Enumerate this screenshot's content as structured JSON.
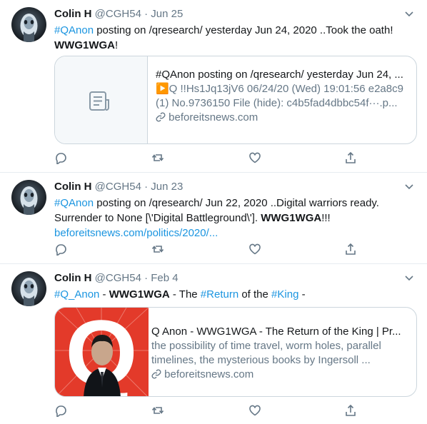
{
  "tweets": [
    {
      "user_name": "Colin H",
      "meta": "@CGH54 · Jun 25",
      "text": {
        "hashtag": "#QAnon",
        "body": " posting on /qresearch/ yesterday Jun 24, 2020 ..Took the oath!",
        "bold": "WWG1WGA",
        "end": "!"
      },
      "card": {
        "title": "#QAnon posting on /qresearch/ yesterday Jun 24, ...",
        "description": "▶️Q !!Hs1Jq13jV6  06/24/20 (Wed) 19:01:56 e2a8c9 (1)  No.9736150 File (hide): c4b5fad4dbbc54f···.p...",
        "domain": "beforeitsnews.com",
        "thumb_icon": "document-icon"
      }
    },
    {
      "user_name": "Colin H",
      "meta": "@CGH54 · Jun 23",
      "text": {
        "hashtag": "#QAnon",
        "body": " posting on /qresearch/ Jun 22, 2020 ..Digital warriors ready. Surrender to None [\\'Digital Battleground\\']. ",
        "bold": "WWG1WGA",
        "end": "!!!",
        "link": "beforeitsnews.com/politics/2020/..."
      }
    },
    {
      "user_name": "Colin H",
      "meta": "@CGH54 · Feb 4",
      "text": {
        "hashtag1": "#Q_Anon",
        "sep1": " - ",
        "bold": "WWG1WGA",
        "sep2": " - The ",
        "hashtag2": "#Return",
        "sep3": " of the ",
        "hashtag3": "#King",
        "end": " -"
      },
      "card": {
        "title": "Q Anon - WWG1WGA - The Return of the King | Pr...",
        "description": "the possibility of time travel, worm holes, parallel timelines, the mysterious books by Ingersoll ...",
        "domain": "beforeitsnews.com",
        "thumb_letter": "Q"
      }
    }
  ],
  "icons": {
    "reply": "reply-icon",
    "retweet": "retweet-icon",
    "like": "heart-icon",
    "share": "share-icon",
    "caret": "chevron-down-icon",
    "link": "link-icon"
  },
  "colors": {
    "accent": "#1b95e0",
    "secondary_text": "#657786",
    "border": "#ccd6dd",
    "card_thumb_red": "#e33a2a"
  }
}
